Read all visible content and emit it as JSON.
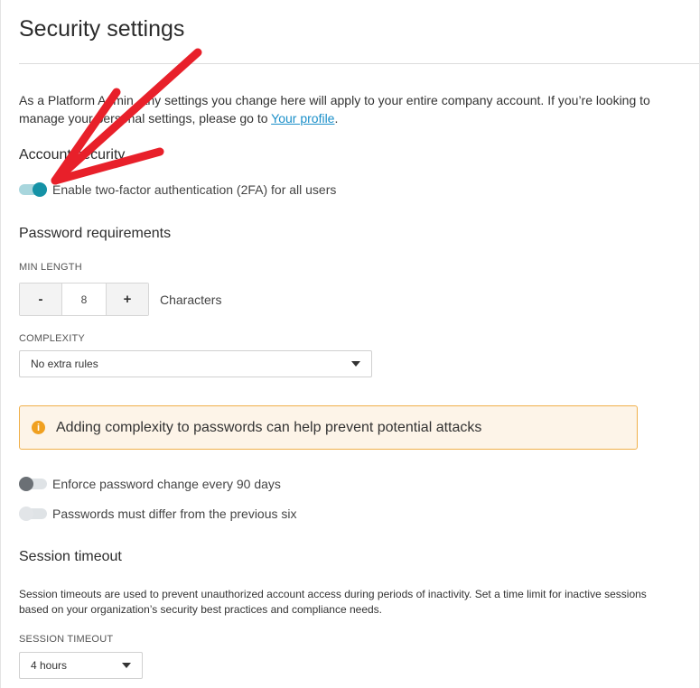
{
  "page": {
    "title": "Security settings",
    "intro_text": "As a Platform Admin, any settings you change here will apply to your entire company account. If you’re looking to manage your personal settings, please go to ",
    "intro_link": "Your profile",
    "intro_end": "."
  },
  "account_security": {
    "heading": "Account security",
    "twofa": {
      "label": "Enable two-factor authentication (2FA) for all users",
      "enabled": true
    }
  },
  "password": {
    "heading": "Password requirements",
    "min_length_label": "MIN LENGTH",
    "minus": "-",
    "plus": "+",
    "min_length_value": "8",
    "characters": "Characters",
    "complexity_label": "COMPLEXITY",
    "complexity_value": "No extra rules",
    "alert_icon": "i",
    "alert": "Adding complexity to passwords can help prevent potential attacks",
    "enforce_change": {
      "label": "Enforce password change every 90 days",
      "enabled": false
    },
    "differ_previous": {
      "label": "Passwords must differ from the previous six",
      "enabled": false
    }
  },
  "session": {
    "heading": "Session timeout",
    "description": "Session timeouts are used to prevent unauthorized account access during periods of inactivity. Set a time limit for inactive sessions based on your organization’s security best practices and compliance needs.",
    "timeout_label": "SESSION TIMEOUT",
    "timeout_value": "4 hours"
  },
  "colors": {
    "accent": "#1592a6",
    "arrow": "#e8202a",
    "link": "#1a8fc9",
    "alert_border": "#f0b04a",
    "alert_bg": "#fdf4e8"
  }
}
